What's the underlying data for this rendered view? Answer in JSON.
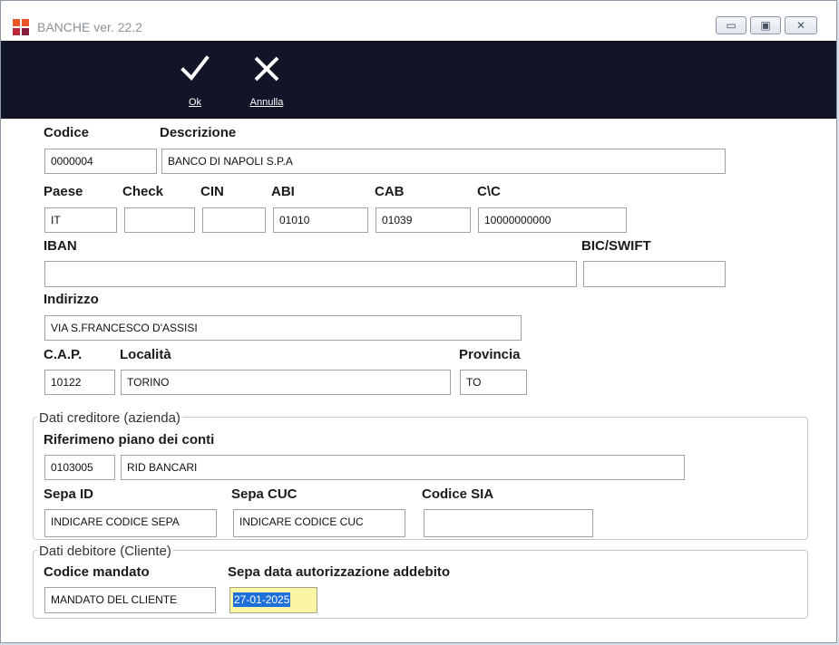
{
  "window": {
    "title": "BANCHE ver. 22.2",
    "min_glyph": "▭",
    "max_glyph": "▣",
    "close_glyph": "✕"
  },
  "toolbar": {
    "ok_label": "Ok",
    "cancel_label": "Annulla"
  },
  "form": {
    "codice": {
      "label": "Codice",
      "value": "0000004"
    },
    "descrizione": {
      "label": "Descrizione",
      "value": "BANCO DI NAPOLI S.P.A"
    },
    "paese": {
      "label": "Paese",
      "value": "IT"
    },
    "check": {
      "label": "Check",
      "value": ""
    },
    "cin": {
      "label": "CIN",
      "value": ""
    },
    "abi": {
      "label": "ABI",
      "value": "01010"
    },
    "cab": {
      "label": "CAB",
      "value": "01039"
    },
    "cc": {
      "label": "C\\C",
      "value": "10000000000"
    },
    "iban": {
      "label": "IBAN",
      "value": ""
    },
    "bic": {
      "label": "BIC/SWIFT",
      "value": ""
    },
    "indirizzo": {
      "label": "Indirizzo",
      "value": "VIA S.FRANCESCO D'ASSISI"
    },
    "cap": {
      "label": "C.A.P.",
      "value": "10122"
    },
    "localita": {
      "label": "Località",
      "value": "TORINO"
    },
    "provincia": {
      "label": "Provincia",
      "value": "TO"
    }
  },
  "creditore": {
    "group_title": "Dati creditore (azienda)",
    "rif_label": "Riferimeno piano dei conti",
    "rif_code": "0103005",
    "rif_desc": "RID BANCARI",
    "sepa_id": {
      "label": "Sepa ID",
      "value": "INDICARE CODICE SEPA"
    },
    "sepa_cuc": {
      "label": "Sepa CUC",
      "value": "INDICARE CODICE CUC"
    },
    "codice_sia": {
      "label": "Codice SIA",
      "value": ""
    }
  },
  "debitore": {
    "group_title": "Dati debitore (Cliente)",
    "mandato": {
      "label": "Codice mandato",
      "value": "MANDATO DEL CLIENTE"
    },
    "data_aut": {
      "label": "Sepa data autorizzazione addebito",
      "value": "27-01-2025"
    }
  },
  "colors": {
    "toolbar_bg": "#121527",
    "highlight": "#fbf6a3",
    "selection": "#1e6fd9"
  }
}
